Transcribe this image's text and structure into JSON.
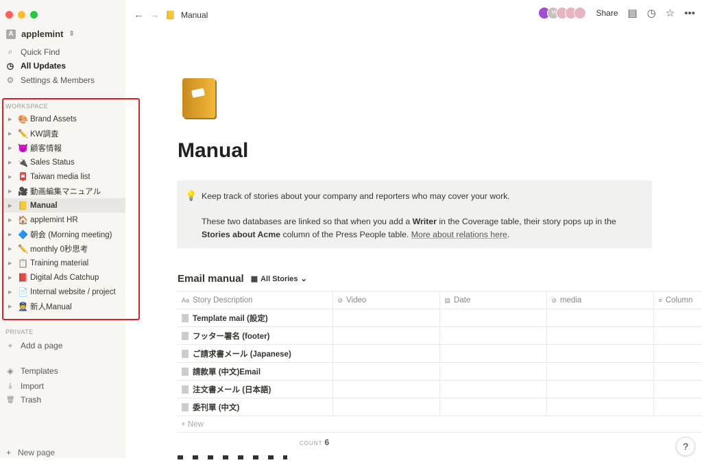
{
  "window": {
    "traffic_colors": [
      "#ff5f57",
      "#febc2e",
      "#28c840"
    ]
  },
  "sidebar": {
    "workspace_name": "applemint",
    "workspace_initial": "A",
    "nav": [
      {
        "label": "Quick Find",
        "icon": "search-icon",
        "glyph": "⌕"
      },
      {
        "label": "All Updates",
        "icon": "clock-icon",
        "glyph": "◷"
      },
      {
        "label": "Settings & Members",
        "icon": "gear-icon",
        "glyph": "⚙"
      }
    ],
    "workspace_label": "WORKSPACE",
    "items": [
      {
        "label": "Brand Assets",
        "emoji": "🎨"
      },
      {
        "label": "KW調査",
        "emoji": "✏️"
      },
      {
        "label": "顧客情報",
        "emoji": "😈"
      },
      {
        "label": "Sales Status",
        "emoji": "🔌"
      },
      {
        "label": "Taiwan media list",
        "emoji": "📮"
      },
      {
        "label": "動画編集マニュアル",
        "emoji": "🎥"
      },
      {
        "label": "Manual",
        "emoji": "📒",
        "selected": true
      },
      {
        "label": "applemint HR",
        "emoji": "🏠"
      },
      {
        "label": "朝会 (Morning meeting)",
        "emoji": "🔷"
      },
      {
        "label": "monthly 0秒思考",
        "emoji": "✏️"
      },
      {
        "label": "Training material",
        "emoji": "📋"
      },
      {
        "label": "Digital Ads Catchup",
        "emoji": "📕"
      },
      {
        "label": "Internal website / project",
        "emoji": "📄"
      },
      {
        "label": "新人Manual",
        "emoji": "👮"
      }
    ],
    "private_label": "PRIVATE",
    "add_page": "Add a page",
    "bottom": [
      {
        "label": "Templates",
        "glyph": "◈"
      },
      {
        "label": "Import",
        "glyph": "⤓"
      },
      {
        "label": "Trash",
        "glyph": "🗑"
      }
    ],
    "new_page": "New page"
  },
  "topbar": {
    "breadcrumb": "Manual",
    "share": "Share",
    "avatar_initial": "M"
  },
  "page": {
    "title": "Manual",
    "callout": {
      "line1": "Keep track of stories about your company and reporters who may cover your work.",
      "p2_a": "These two databases are linked so that when you add a ",
      "p2_b": "Writer",
      "p2_c": " in the Coverage table, their story pops up in the ",
      "p2_d": "Stories about Acme",
      "p2_e": " column of the Press People table. ",
      "p2_link": "More about relations here",
      "p2_f": "."
    },
    "database": {
      "title": "Email manual",
      "view": "All Stories",
      "columns": [
        {
          "label": "Story Description",
          "glyph": "Aa"
        },
        {
          "label": "Video",
          "glyph": "⊘"
        },
        {
          "label": "Date",
          "glyph": "▤"
        },
        {
          "label": "media",
          "glyph": "⊘"
        },
        {
          "label": "Column",
          "glyph": "≡"
        }
      ],
      "rows": [
        "Template mail (設定)",
        "フッター署名 (footer)",
        "ご請求書メール (Japanese)",
        "請款單 (中文)Email",
        "注文書メール (日本語)",
        "委刊單 (中文)"
      ],
      "new_label": "New",
      "count_label": "COUNT",
      "count": "6"
    }
  },
  "help": "?"
}
